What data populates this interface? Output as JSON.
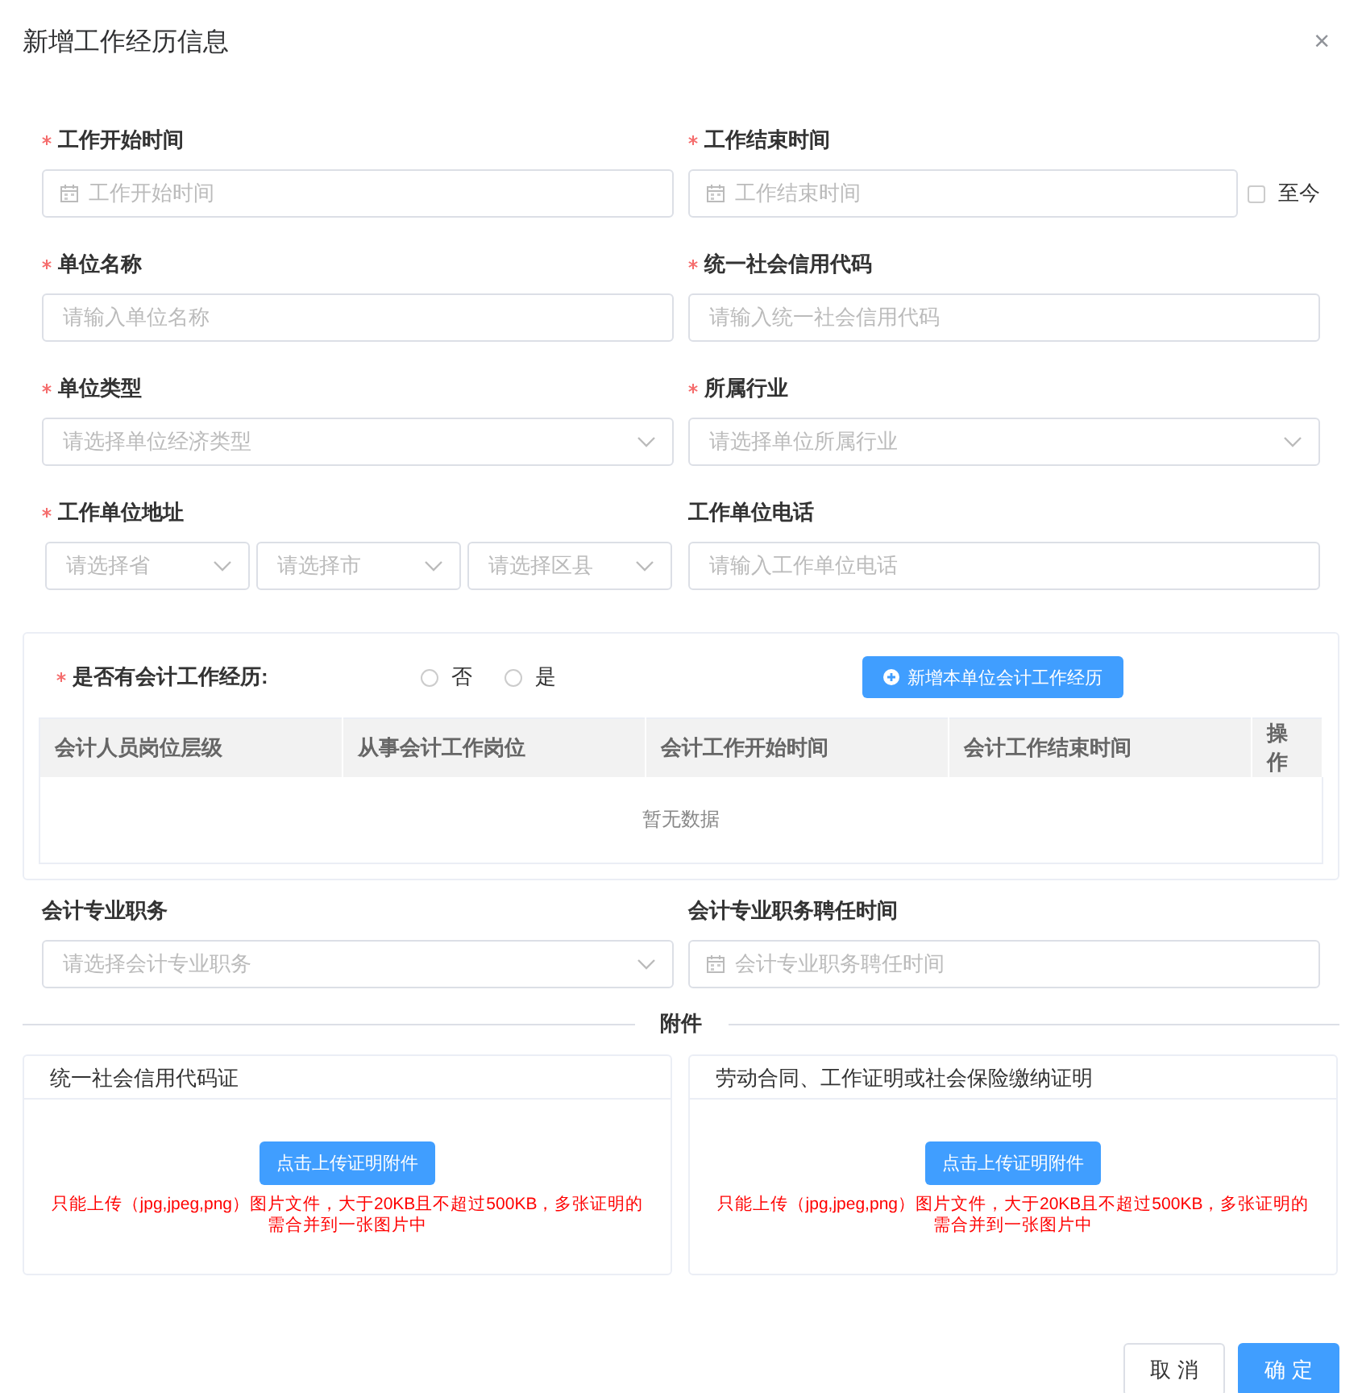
{
  "dialog": {
    "title": "新增工作经历信息",
    "close": "×"
  },
  "fields": [
    {
      "label": "工作开始时间",
      "required": true,
      "kind": "date",
      "placeholder": "工作开始时间"
    },
    {
      "label": "工作结束时间",
      "required": true,
      "kind": "date",
      "placeholder": "工作结束时间",
      "today_option": {
        "label": "至今",
        "checked": false
      }
    },
    {
      "label": "单位名称",
      "required": true,
      "kind": "text",
      "placeholder": "请输入单位名称"
    },
    {
      "label": "统一社会信用代码",
      "required": true,
      "kind": "text",
      "placeholder": "请输入统一社会信用代码"
    },
    {
      "label": "单位类型",
      "required": true,
      "kind": "select",
      "placeholder": "请选择单位经济类型"
    },
    {
      "label": "所属行业",
      "required": true,
      "kind": "select",
      "placeholder": "请选择单位所属行业"
    },
    {
      "label": "工作单位地址",
      "required": true,
      "kind": "address",
      "selects": [
        {
          "placeholder": "请选择省"
        },
        {
          "placeholder": "请选择市"
        },
        {
          "placeholder": "请选择区县"
        }
      ]
    },
    {
      "label": "工作单位电话",
      "required": false,
      "kind": "text",
      "placeholder": "请输入工作单位电话"
    }
  ],
  "accounting": {
    "label": "是否有会计工作经历:",
    "required": true,
    "options": [
      {
        "label": "否",
        "selected": false
      },
      {
        "label": "是",
        "selected": false
      }
    ],
    "add_button": "新增本单位会计工作经历",
    "table": {
      "columns": [
        "会计人员岗位层级",
        "从事会计工作岗位",
        "会计工作开始时间",
        "会计工作结束时间",
        "操作"
      ],
      "empty_text": "暂无数据"
    }
  },
  "fields_2": [
    {
      "label": "会计专业职务",
      "required": false,
      "kind": "select",
      "placeholder": "请选择会计专业职务"
    },
    {
      "label": "会计专业职务聘任时间",
      "required": false,
      "kind": "date",
      "placeholder": "会计专业职务聘任时间"
    }
  ],
  "attachments": {
    "title": "附件",
    "uploads": [
      {
        "title": "统一社会信用代码证",
        "button": "点击上传证明附件",
        "hint": "只能上传（jpg,jpeg,png）图片文件，大于20KB且不超过500KB，多张证明的需合并到一张图片中"
      },
      {
        "title": "劳动合同、工作证明或社会保险缴纳证明",
        "button": "点击上传证明附件",
        "hint": "只能上传（jpg,jpeg,png）图片文件，大于20KB且不超过500KB，多张证明的需合并到一张图片中"
      }
    ]
  },
  "footer": {
    "buttons": [
      {
        "label": "取 消",
        "kind": "default"
      },
      {
        "label": "确 定",
        "kind": "primary"
      }
    ]
  }
}
